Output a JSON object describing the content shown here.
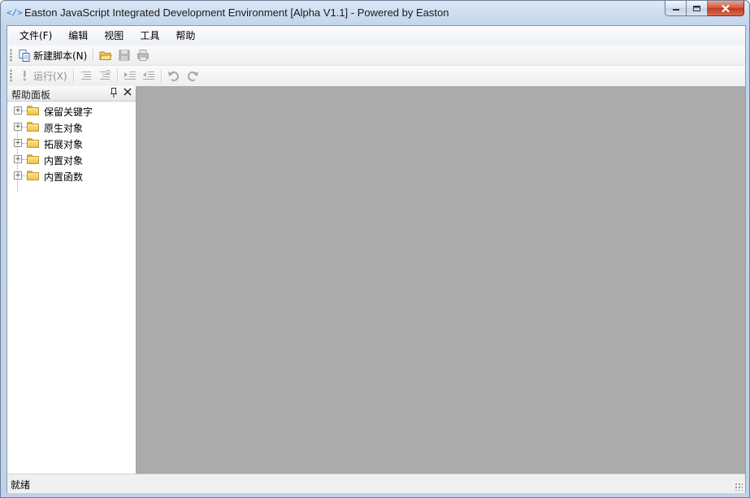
{
  "window": {
    "title": "Easton JavaScript Integrated Development Environment [Alpha V1.1] - Powered by Easton",
    "app_icon": "code-brackets-icon",
    "app_icon_text": "</>"
  },
  "menubar": {
    "items": [
      {
        "label": "文件(F)"
      },
      {
        "label": "编辑"
      },
      {
        "label": "视图"
      },
      {
        "label": "工具"
      },
      {
        "label": "帮助"
      }
    ]
  },
  "toolbar1": {
    "new_script_label": "新建脚本(N)"
  },
  "toolbar2": {
    "run_label": "运行(X)"
  },
  "help_panel": {
    "title": "帮助面板",
    "items": [
      {
        "label": "保留关键字"
      },
      {
        "label": "原生对象"
      },
      {
        "label": "拓展对象"
      },
      {
        "label": "内置对象"
      },
      {
        "label": "内置函数"
      }
    ]
  },
  "statusbar": {
    "text": "就绪"
  },
  "colors": {
    "workspace": "#ababab",
    "title_bar": "#c3d5eb",
    "close_button": "#c8452b"
  }
}
